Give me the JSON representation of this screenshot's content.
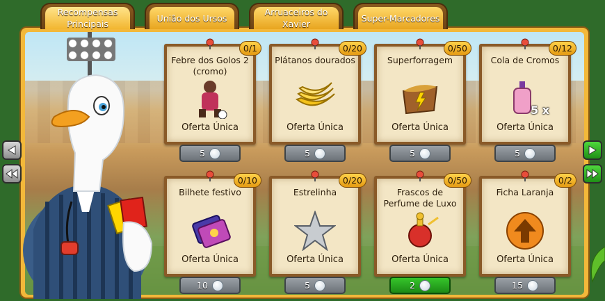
{
  "tabs": [
    {
      "label": "Recompensas Principais",
      "active": true
    },
    {
      "label": "União dos Ursos",
      "active": false
    },
    {
      "label": "Arruaceiros do Xavier",
      "active": false
    },
    {
      "label": "Super-Marcadores",
      "active": false
    }
  ],
  "cards": [
    {
      "title": "Febre dos Golos 2 (cromo)",
      "counter": "0/1",
      "offer": "Oferta Única",
      "price": "5",
      "icon": "bear-sticker-icon"
    },
    {
      "title": "Plátanos dourados",
      "counter": "0/20",
      "offer": "Oferta Única",
      "price": "5",
      "icon": "golden-bananas-icon"
    },
    {
      "title": "Superforragem",
      "counter": "0/50",
      "offer": "Oferta Única",
      "price": "5",
      "icon": "super-fodder-icon"
    },
    {
      "title": "Cola de Cromos",
      "counter": "0/12",
      "offer": "Oferta Única",
      "price": "5",
      "icon": "sticker-glue-icon",
      "badge": "5 x"
    },
    {
      "title": "Bilhete festivo",
      "counter": "0/10",
      "offer": "Oferta Única",
      "price": "10",
      "icon": "festive-ticket-icon"
    },
    {
      "title": "Estrelinha",
      "counter": "0/20",
      "offer": "Oferta Única",
      "price": "5",
      "icon": "silver-star-icon"
    },
    {
      "title": "Frascos de Perfume de Luxo",
      "counter": "0/50",
      "offer": "Oferta Única",
      "price": "2",
      "icon": "luxury-perfume-icon",
      "highlight": true
    },
    {
      "title": "Ficha Laranja",
      "counter": "0/2",
      "offer": "Oferta Única",
      "price": "15",
      "icon": "orange-token-icon"
    }
  ],
  "colors": {
    "accent": "#f3b83a",
    "price_green": "#1c8a16",
    "price_grey": "#6c7278"
  }
}
